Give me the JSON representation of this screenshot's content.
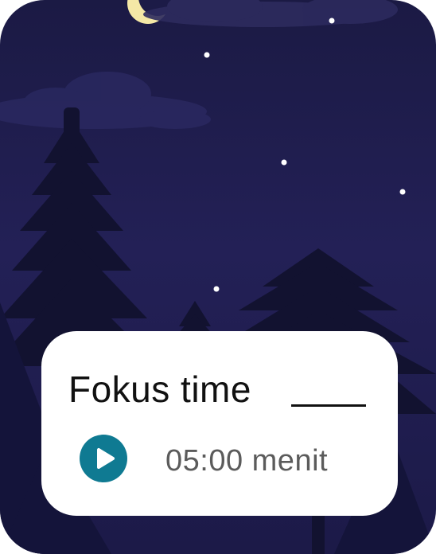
{
  "card": {
    "title": "Fokus time",
    "duration": "05:00 menit",
    "play_icon": "play-icon"
  },
  "colors": {
    "sky": "#1f1d4e",
    "trees": "#121230",
    "moon": "#f4e8a6",
    "accent": "#0f7a92",
    "card": "#ffffff"
  }
}
